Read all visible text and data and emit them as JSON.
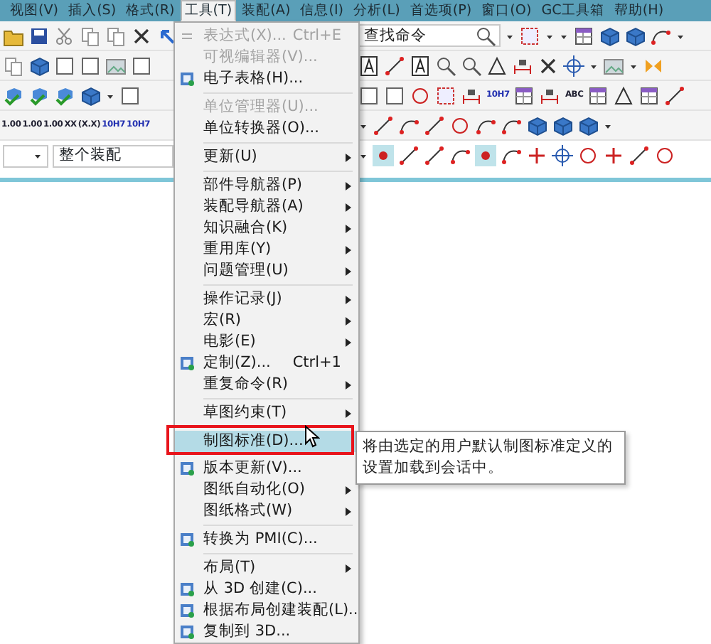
{
  "menubar": [
    {
      "label": "视图(V)",
      "selected": false
    },
    {
      "label": "插入(S)",
      "selected": false
    },
    {
      "label": "格式(R)",
      "selected": false
    },
    {
      "label": "工具(T)",
      "selected": true
    },
    {
      "label": "装配(A)",
      "selected": false
    },
    {
      "label": "信息(I)",
      "selected": false
    },
    {
      "label": "分析(L)",
      "selected": false
    },
    {
      "label": "首选项(P)",
      "selected": false
    },
    {
      "label": "窗口(O)",
      "selected": false
    },
    {
      "label": "GC工具箱",
      "selected": false
    },
    {
      "label": "帮助(H)",
      "selected": false
    }
  ],
  "search": {
    "placeholder": "查找命令"
  },
  "annotation_buttons": [
    "10H7",
    "ABC"
  ],
  "dimension_buttons": [
    "1.00",
    "1.00",
    "1.00",
    "XX",
    "(X.X)",
    "10H7",
    "10H7"
  ],
  "scope_combo": {
    "value": "整个装配"
  },
  "menu": {
    "items": [
      {
        "kind": "item",
        "label": "表达式(X)...",
        "shortcut": "Ctrl+E",
        "icon": true,
        "disabled": true,
        "submenu": false,
        "selected": false,
        "outlined": false
      },
      {
        "kind": "item",
        "label": "可视编辑器(V)...",
        "icon": false,
        "disabled": true,
        "submenu": false,
        "selected": false,
        "outlined": false
      },
      {
        "kind": "item",
        "label": "电子表格(H)...",
        "icon": true,
        "disabled": false,
        "submenu": false,
        "selected": false,
        "outlined": false
      },
      {
        "kind": "separator"
      },
      {
        "kind": "item",
        "label": "单位管理器(U)...",
        "icon": false,
        "disabled": true,
        "submenu": false,
        "selected": false,
        "outlined": false
      },
      {
        "kind": "item",
        "label": "单位转换器(O)...",
        "icon": false,
        "disabled": false,
        "submenu": false,
        "selected": false,
        "outlined": false
      },
      {
        "kind": "separator"
      },
      {
        "kind": "item",
        "label": "更新(U)",
        "icon": false,
        "disabled": false,
        "submenu": true,
        "selected": false,
        "outlined": false
      },
      {
        "kind": "separator"
      },
      {
        "kind": "item",
        "label": "部件导航器(P)",
        "icon": false,
        "disabled": false,
        "submenu": true,
        "selected": false,
        "outlined": false
      },
      {
        "kind": "item",
        "label": "装配导航器(A)",
        "icon": false,
        "disabled": false,
        "submenu": true,
        "selected": false,
        "outlined": false
      },
      {
        "kind": "item",
        "label": "知识融合(K)",
        "icon": false,
        "disabled": false,
        "submenu": true,
        "selected": false,
        "outlined": false
      },
      {
        "kind": "item",
        "label": "重用库(Y)",
        "icon": false,
        "disabled": false,
        "submenu": true,
        "selected": false,
        "outlined": false
      },
      {
        "kind": "item",
        "label": "问题管理(U)",
        "icon": false,
        "disabled": false,
        "submenu": true,
        "selected": false,
        "outlined": false
      },
      {
        "kind": "separator"
      },
      {
        "kind": "item",
        "label": "操作记录(J)",
        "icon": false,
        "disabled": false,
        "submenu": true,
        "selected": false,
        "outlined": false
      },
      {
        "kind": "item",
        "label": "宏(R)",
        "icon": false,
        "disabled": false,
        "submenu": true,
        "selected": false,
        "outlined": false
      },
      {
        "kind": "item",
        "label": "电影(E)",
        "icon": false,
        "disabled": false,
        "submenu": true,
        "selected": false,
        "outlined": false
      },
      {
        "kind": "item",
        "label": "定制(Z)...",
        "shortcut": "Ctrl+1",
        "icon": true,
        "disabled": false,
        "submenu": false,
        "selected": false,
        "outlined": false
      },
      {
        "kind": "item",
        "label": "重复命令(R)",
        "icon": false,
        "disabled": false,
        "submenu": true,
        "selected": false,
        "outlined": false
      },
      {
        "kind": "separator"
      },
      {
        "kind": "item",
        "label": "草图约束(T)",
        "icon": false,
        "disabled": false,
        "submenu": true,
        "selected": false,
        "outlined": false
      },
      {
        "kind": "separator"
      },
      {
        "kind": "item",
        "label": "制图标准(D)...",
        "icon": false,
        "disabled": false,
        "submenu": false,
        "selected": true,
        "outlined": true
      },
      {
        "kind": "item",
        "label": "版本更新(V)...",
        "icon": true,
        "disabled": false,
        "submenu": false,
        "selected": false,
        "outlined": false
      },
      {
        "kind": "item",
        "label": "图纸自动化(O)",
        "icon": false,
        "disabled": false,
        "submenu": true,
        "selected": false,
        "outlined": false
      },
      {
        "kind": "item",
        "label": "图纸格式(W)",
        "icon": false,
        "disabled": false,
        "submenu": true,
        "selected": false,
        "outlined": false
      },
      {
        "kind": "separator"
      },
      {
        "kind": "item",
        "label": "转换为 PMI(C)...",
        "icon": true,
        "disabled": false,
        "submenu": false,
        "selected": false,
        "outlined": false
      },
      {
        "kind": "separator"
      },
      {
        "kind": "item",
        "label": "布局(T)",
        "icon": false,
        "disabled": false,
        "submenu": true,
        "selected": false,
        "outlined": false
      },
      {
        "kind": "item",
        "label": "从 3D 创建(C)...",
        "icon": true,
        "disabled": false,
        "submenu": false,
        "selected": false,
        "outlined": false
      },
      {
        "kind": "item",
        "label": "根据布局创建装配(L)...",
        "icon": true,
        "disabled": false,
        "submenu": false,
        "selected": false,
        "outlined": false
      },
      {
        "kind": "item",
        "label": "复制到 3D...",
        "icon": true,
        "disabled": false,
        "submenu": false,
        "selected": false,
        "outlined": false
      }
    ]
  },
  "tooltip": {
    "text": "将由选定的用户默认制图标准定义的设置加载到会话中。"
  }
}
